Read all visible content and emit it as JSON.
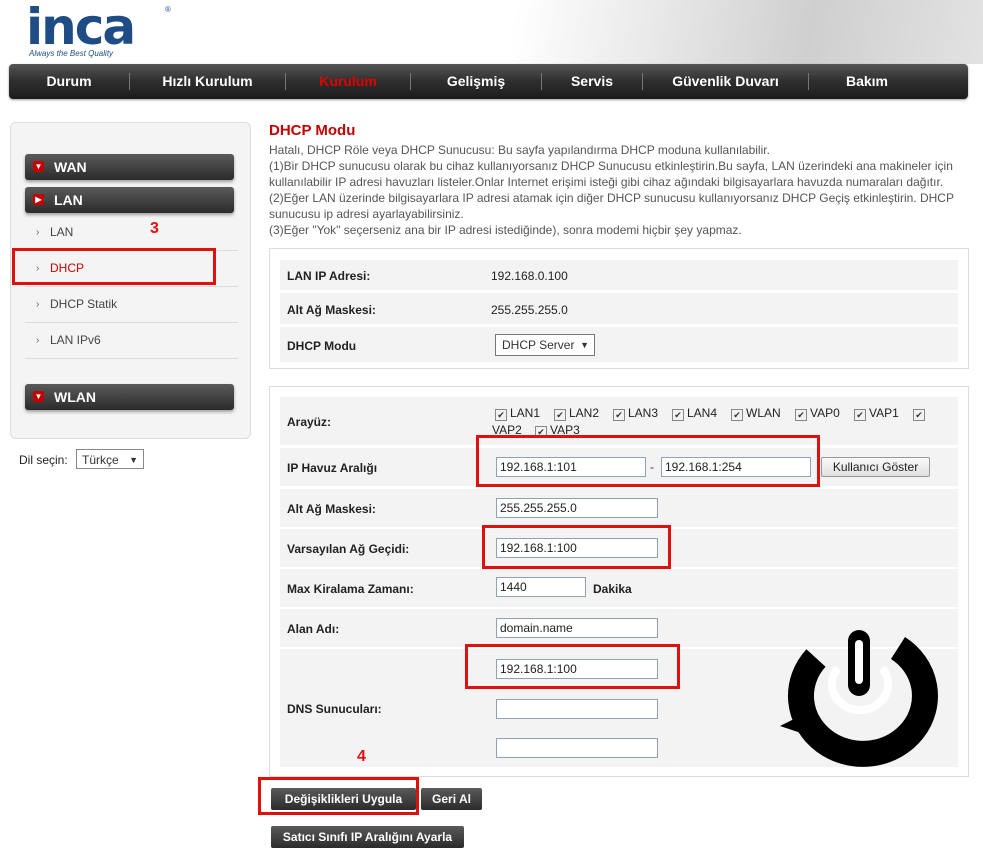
{
  "brand": {
    "name": "inca",
    "tagline": "Always the Best Quality",
    "reg": "®"
  },
  "nav": {
    "tabs": [
      {
        "label": "Durum"
      },
      {
        "label": "Hızlı Kurulum"
      },
      {
        "label": "Kurulum",
        "active": true
      },
      {
        "label": "Gelişmiş"
      },
      {
        "label": "Servis"
      },
      {
        "label": "Güvenlik Duvarı"
      },
      {
        "label": "Bakım"
      }
    ]
  },
  "sidebar": {
    "wan": "WAN",
    "lan": "LAN",
    "wlan": "WLAN",
    "lan_items": [
      "LAN",
      "DHCP",
      "DHCP Statik",
      "LAN IPv6"
    ],
    "active_item": "DHCP",
    "language_label": "Dil seçin:",
    "language_value": "Türkçe"
  },
  "page": {
    "title": "DHCP Modu",
    "description": [
      "Hatalı, DHCP Röle veya DHCP Sunucusu: Bu sayfa yapılandırma DHCP moduna kullanılabilir.",
      "(1)Bir DHCP sunucusu olarak bu cihaz kullanıyorsanız DHCP Sunucusu etkinleştirin.Bu sayfa, LAN üzerindeki ana makineler için",
      "kullanılabilir IP adresi havuzları listeler.Onlar Internet erişimi isteği gibi cihaz ağındaki bilgisayarlara havuzda numaraları dağıtır.",
      "(2)Eğer LAN üzerinde bilgisayarlara IP adresi atamak için diğer DHCP sunucusu kullanıyorsanız DHCP Geçiş etkinleştirin. DHCP",
      "sunucusu ip adresi ayarlayabilirsiniz.",
      "(3)Eğer \"Yok\" seçerseniz ana bir IP adresi istediğinde), sonra modemi hiçbir şey yapmaz."
    ]
  },
  "lan_info": {
    "lan_ip_label": "LAN IP Adresi:",
    "lan_ip_value": "192.168.0.100",
    "mask_label": "Alt Ağ Maskesi:",
    "mask_value": "255.255.255.0",
    "mode_label": "DHCP Modu",
    "mode_value": "DHCP Server"
  },
  "dhcp": {
    "interface_label": "Arayüz:",
    "interfaces": [
      "LAN1",
      "LAN2",
      "LAN3",
      "LAN4",
      "WLAN",
      "VAP0",
      "VAP1",
      "VAP2",
      "VAP3"
    ],
    "pool_label": "IP Havuz Aralığı",
    "pool_start": "192.168.1:101",
    "pool_sep": "-",
    "pool_end": "192.168.1:254",
    "show_clients": "Kullanıcı Göster",
    "mask_label": "Alt Ağ Maskesi:",
    "mask_value": "255.255.255.0",
    "gateway_label": "Varsayılan Ağ Geçidi:",
    "gateway_value": "192.168.1:100",
    "lease_label": "Max Kiralama Zamanı:",
    "lease_value": "1440",
    "lease_unit": "Dakika",
    "domain_label": "Alan Adı:",
    "domain_value": "domain.name",
    "dns_label": "DNS Sunucuları:",
    "dns1": "192.168.1:100",
    "dns2": "",
    "dns3": ""
  },
  "buttons": {
    "apply": "Değişiklikleri Uygula",
    "undo": "Geri Al",
    "vendor": "Satıcı Sınıfı IP Aralığını Ayarla"
  },
  "annotations": {
    "step3": "3",
    "step4": "4"
  },
  "colors": {
    "accent_red": "#c40000",
    "nav_dark": "#2b2b2b",
    "highlight": "#e01010"
  }
}
